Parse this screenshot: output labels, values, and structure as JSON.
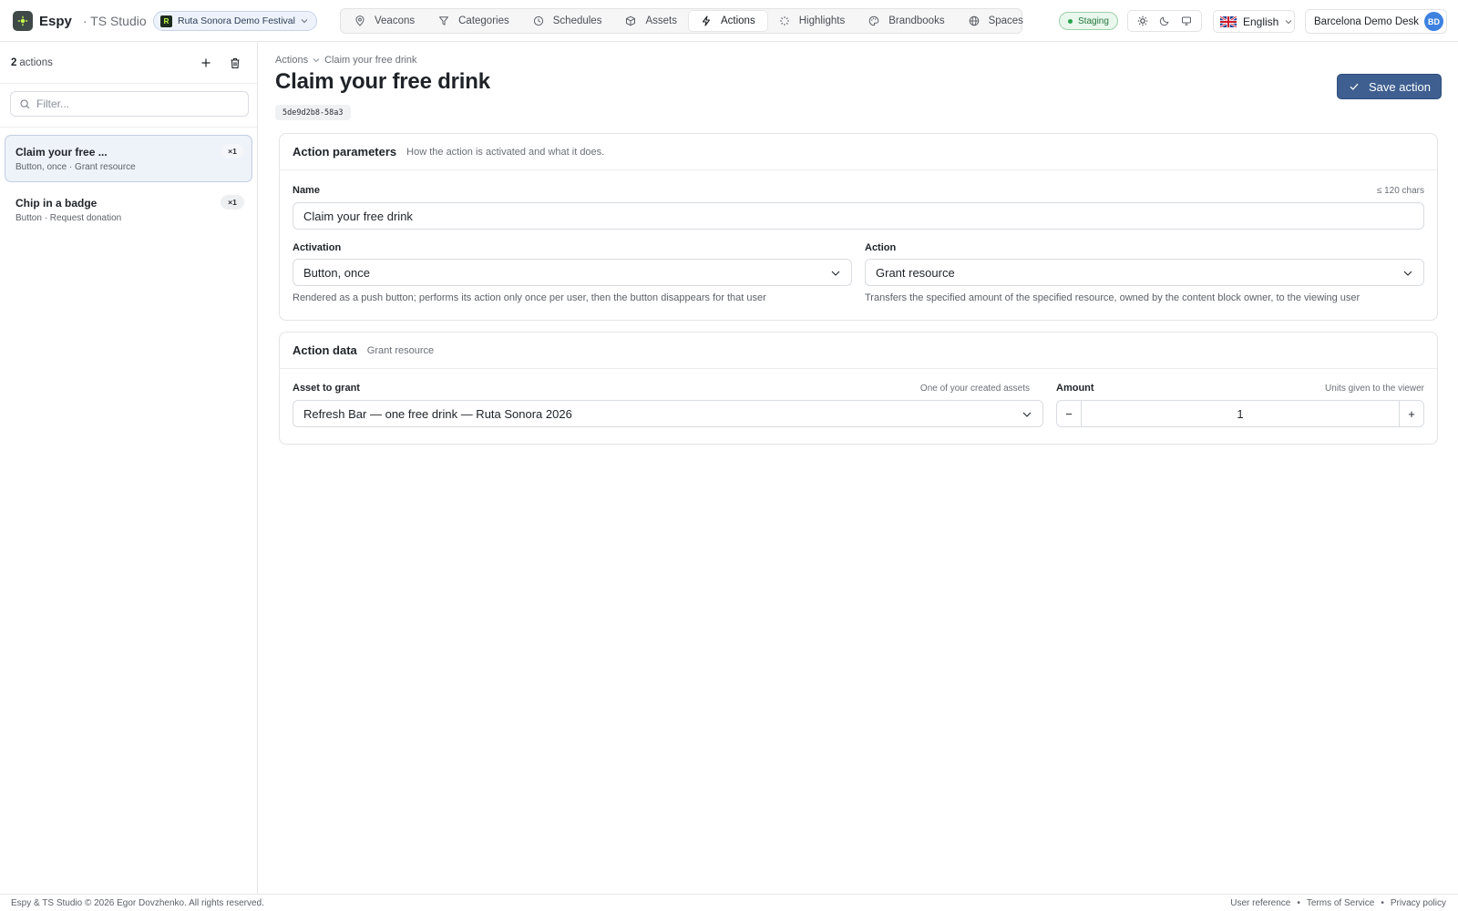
{
  "app": {
    "name": "Espy",
    "subtitle": "· TS Studio"
  },
  "project": {
    "name": "Ruta Sonora Demo Festival",
    "icon_letter": "R"
  },
  "nav": {
    "tabs": [
      {
        "label": "Veacons",
        "icon": "map-pin-icon"
      },
      {
        "label": "Categories",
        "icon": "filter-icon"
      },
      {
        "label": "Schedules",
        "icon": "clock-icon"
      },
      {
        "label": "Assets",
        "icon": "box-icon"
      },
      {
        "label": "Actions",
        "icon": "bolt-icon",
        "active": true
      },
      {
        "label": "Highlights",
        "icon": "sparkle-icon"
      },
      {
        "label": "Brandbooks",
        "icon": "palette-icon"
      },
      {
        "label": "Spaces",
        "icon": "globe-icon"
      }
    ]
  },
  "environment": {
    "label": "Staging",
    "color": "#2aa34f"
  },
  "language": {
    "label": "English",
    "flag": "uk-flag-icon"
  },
  "user": {
    "name": "Barcelona Demo Desk",
    "initials": "BD",
    "color": "#3d82e0"
  },
  "sidebar": {
    "count": "2",
    "count_label": "actions",
    "filter_placeholder": "Filter...",
    "items": [
      {
        "title": "Claim your free ...",
        "subtitle": "Button, once · Grant resource",
        "badge": "×1",
        "active": true
      },
      {
        "title": "Chip in a badge",
        "subtitle": "Button · Request donation",
        "badge": "×1",
        "active": false
      }
    ]
  },
  "main": {
    "breadcrumb": {
      "parent": "Actions",
      "current": "Claim your free drink"
    },
    "title": "Claim your free drink",
    "uuid": "5de9d2b8-58a3",
    "save_label": "Save action",
    "accent": "#3e5f90"
  },
  "params_card": {
    "title": "Action parameters",
    "description": "How the action is activated and what it does.",
    "name_label": "Name",
    "name_hint": "≤ 120 chars",
    "name_value": "Claim your free drink",
    "activation_label": "Activation",
    "activation_value": "Button, once",
    "activation_help": "Rendered as a push button; performs its action only once per user, then the button disappears for that user",
    "action_label": "Action",
    "action_value": "Grant resource",
    "action_help": "Transfers the specified amount of the specified resource, owned by the content block owner, to the viewing user"
  },
  "data_card": {
    "title": "Action data",
    "description": "Grant resource",
    "asset_label": "Asset to grant",
    "asset_hint": "One of your created assets",
    "asset_value": "Refresh Bar — one free drink — Ruta Sonora 2026",
    "amount_label": "Amount",
    "amount_hint": "Units given to the viewer",
    "amount_value": "1",
    "minus": "−",
    "plus": "+"
  },
  "footer": {
    "copyright": "Espy & TS Studio © 2026 Egor Dovzhenko. All rights reserved.",
    "links": [
      "User reference",
      "Terms of Service",
      "Privacy policy"
    ],
    "bullet": "•"
  }
}
